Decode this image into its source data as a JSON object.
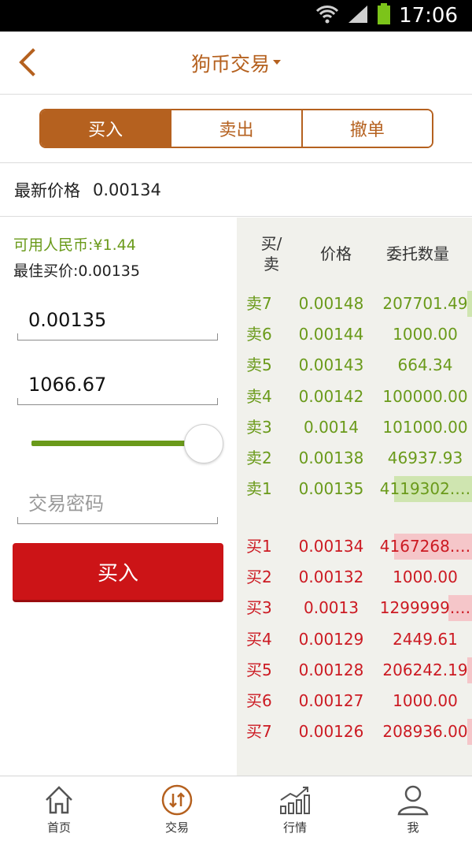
{
  "status_bar": {
    "time": "17:06"
  },
  "header": {
    "title": "狗币交易"
  },
  "tabs": [
    {
      "label": "买入",
      "active": true
    },
    {
      "label": "卖出",
      "active": false
    },
    {
      "label": "撤单",
      "active": false
    }
  ],
  "latest": {
    "label": "最新价格",
    "value": "0.00134"
  },
  "form": {
    "available": "可用人民币:¥1.44",
    "best_price": "最佳买价:0.00135",
    "price_value": "0.00135",
    "quantity_value": "1066.67",
    "slider_percent": 100,
    "password_placeholder": "交易密码",
    "submit_label": "买入"
  },
  "order_book": {
    "headers": {
      "side": "买/卖",
      "price": "价格",
      "quantity": "委托数量"
    },
    "sells": [
      {
        "side": "卖7",
        "price": "0.00148",
        "quantity": "207701.49",
        "depth": 0.02
      },
      {
        "side": "卖6",
        "price": "0.00144",
        "quantity": "1000.00",
        "depth": 0
      },
      {
        "side": "卖5",
        "price": "0.00143",
        "quantity": "664.34",
        "depth": 0
      },
      {
        "side": "卖4",
        "price": "0.00142",
        "quantity": "100000.00",
        "depth": 0
      },
      {
        "side": "卖3",
        "price": "0.0014",
        "quantity": "101000.00",
        "depth": 0
      },
      {
        "side": "卖2",
        "price": "0.00138",
        "quantity": "46937.93",
        "depth": 0
      },
      {
        "side": "卖1",
        "price": "0.00135",
        "quantity": "4119302.…",
        "depth": 0.33
      }
    ],
    "buys": [
      {
        "side": "买1",
        "price": "0.00134",
        "quantity": "4167268.…",
        "depth": 0.33
      },
      {
        "side": "买2",
        "price": "0.00132",
        "quantity": "1000.00",
        "depth": 0
      },
      {
        "side": "买3",
        "price": "0.0013",
        "quantity": "1299999.…",
        "depth": 0.1
      },
      {
        "side": "买4",
        "price": "0.00129",
        "quantity": "2449.61",
        "depth": 0
      },
      {
        "side": "买5",
        "price": "0.00128",
        "quantity": "206242.19",
        "depth": 0.02
      },
      {
        "side": "买6",
        "price": "0.00127",
        "quantity": "1000.00",
        "depth": 0
      },
      {
        "side": "买7",
        "price": "0.00126",
        "quantity": "208936.00",
        "depth": 0.02
      }
    ]
  },
  "bottom_nav": [
    {
      "label": "首页",
      "icon": "home-icon",
      "active": false
    },
    {
      "label": "交易",
      "icon": "trade-icon",
      "active": true
    },
    {
      "label": "行情",
      "icon": "market-chart-icon",
      "active": false
    },
    {
      "label": "我",
      "icon": "user-icon",
      "active": false
    }
  ],
  "colors": {
    "accent": "#b5611f",
    "sell_green": "#6a9a1a",
    "buy_red": "#cc1a22",
    "button_red": "#cc1417"
  }
}
